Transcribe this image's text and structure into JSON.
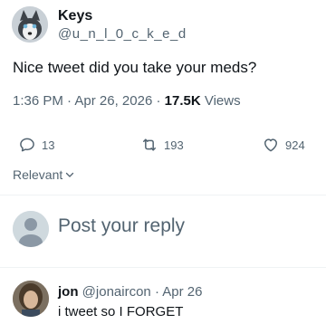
{
  "tweet": {
    "author_name": "Keys",
    "author_handle": "@u_n_l_0_c_k_e_d",
    "text": "Nice tweet did you take your meds?",
    "time": "1:36 PM",
    "date": "Apr 26, 2026",
    "views_count": "17.5K",
    "views_label": "Views",
    "separator": "·"
  },
  "actions": {
    "reply_count": "13",
    "retweet_count": "193",
    "like_count": "924"
  },
  "sort": {
    "label": "Relevant"
  },
  "composer": {
    "placeholder": "Post your reply"
  },
  "reply": {
    "name": "jon",
    "handle": "@jonaircon",
    "date": "Apr 26",
    "separator": "·",
    "text": "i tweet so I FORGET"
  },
  "icons": {
    "reply": "speech-bubble-icon",
    "retweet": "retweet-icon",
    "like": "heart-icon",
    "sort": "chevron-down-icon"
  }
}
